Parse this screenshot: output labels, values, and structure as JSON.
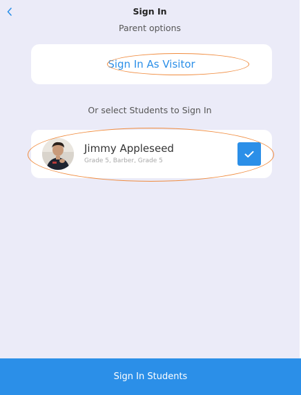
{
  "nav": {
    "back_icon": "chevron-left-icon",
    "title": "Sign In",
    "subtitle": "Parent options"
  },
  "visitor": {
    "label": "Sign In As Visitor"
  },
  "select_hint": "Or select Students to Sign In",
  "students": [
    {
      "name": "Jimmy Appleseed",
      "details": "Grade 5, Barber, Grade 5",
      "selected": true,
      "avatar_icon": "student-photo"
    }
  ],
  "bottom_button": {
    "label": "Sign In Students"
  },
  "colors": {
    "background": "#ebebf8",
    "accent": "#2b8fe8",
    "annotation": "#f08a3c",
    "card": "#ffffff"
  }
}
